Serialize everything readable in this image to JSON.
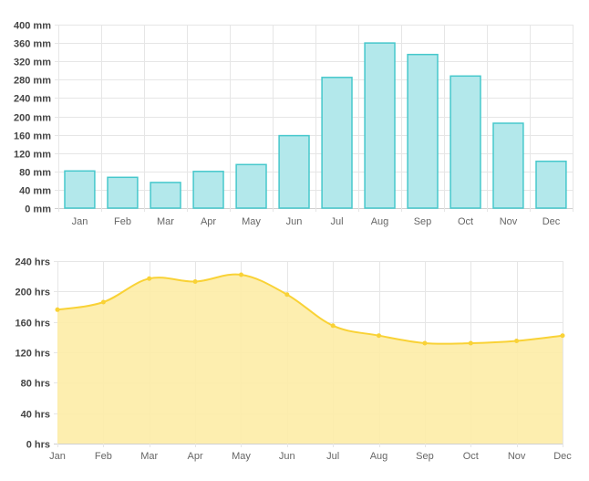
{
  "chart_data": [
    {
      "type": "bar",
      "categories": [
        "Jan",
        "Feb",
        "Mar",
        "Apr",
        "May",
        "Jun",
        "Jul",
        "Aug",
        "Sep",
        "Oct",
        "Nov",
        "Dec"
      ],
      "values": [
        81,
        67,
        56,
        80,
        95,
        158,
        285,
        360,
        335,
        288,
        185,
        102
      ],
      "yticks": [
        "0 mm",
        "40 mm",
        "80 mm",
        "120 mm",
        "160 mm",
        "200 mm",
        "240 mm",
        "280 mm",
        "320 mm",
        "360 mm",
        "400 mm"
      ],
      "ylim": [
        0,
        400
      ],
      "grid": true,
      "colors": {
        "fill": "#b3e8eb",
        "stroke": "#46c8cc"
      }
    },
    {
      "type": "area",
      "categories": [
        "Jan",
        "Feb",
        "Mar",
        "Apr",
        "May",
        "Jun",
        "Jul",
        "Aug",
        "Sep",
        "Oct",
        "Nov",
        "Dec"
      ],
      "values": [
        176,
        186,
        217,
        213,
        222,
        196,
        155,
        142,
        132,
        132,
        135,
        142
      ],
      "yticks": [
        "0 hrs",
        "40 hrs",
        "80 hrs",
        "120 hrs",
        "160 hrs",
        "200 hrs",
        "240 hrs"
      ],
      "ylim": [
        0,
        240
      ],
      "grid": true,
      "colors": {
        "fill": "#fdeca6",
        "stroke": "#f9d236",
        "point": "#f9d236"
      }
    }
  ]
}
